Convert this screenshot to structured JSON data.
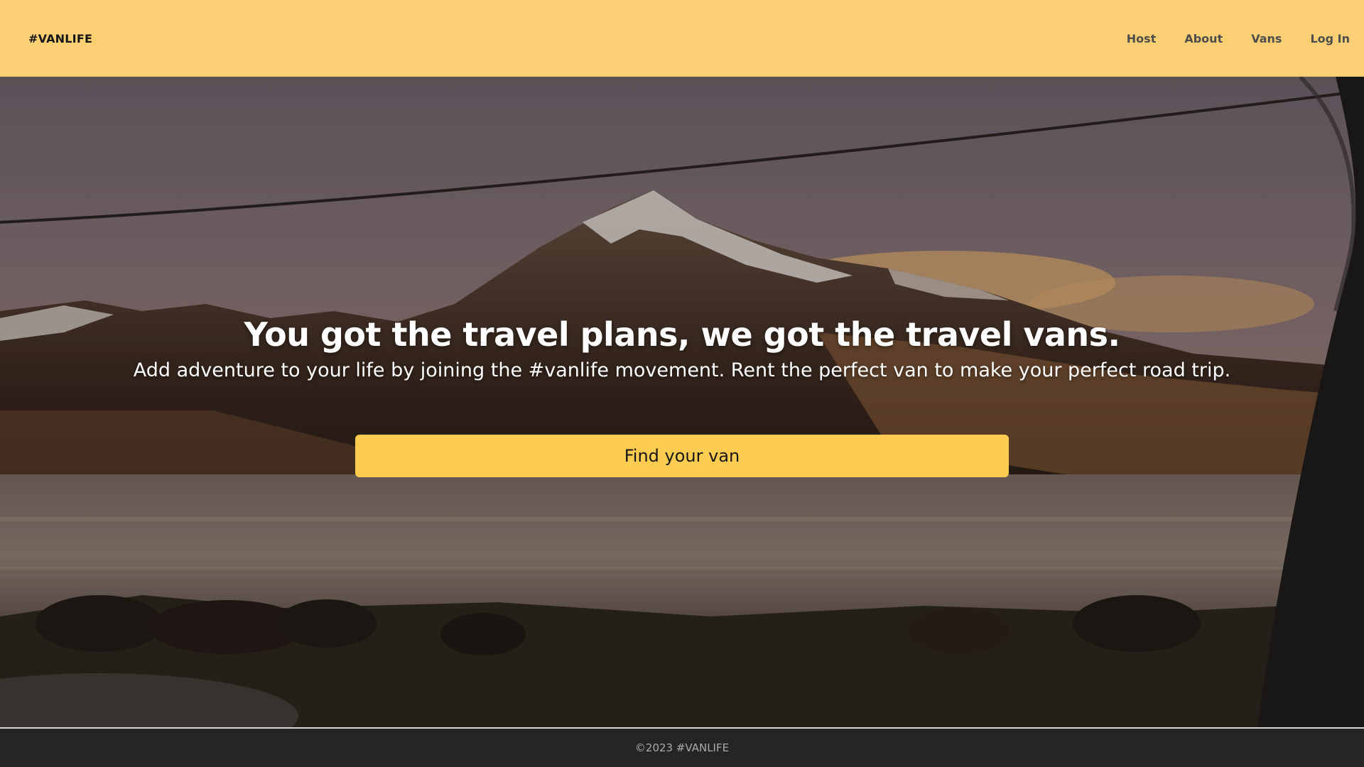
{
  "header": {
    "logo": "#VANLIFE",
    "nav": [
      {
        "label": "Host"
      },
      {
        "label": "About"
      },
      {
        "label": "Vans"
      },
      {
        "label": "Log In"
      }
    ]
  },
  "hero": {
    "title": "You got the travel plans, we got the travel vans.",
    "subtitle": "Add adventure to your life by joining the #vanlife movement. Rent the perfect van to make your perfect road trip.",
    "cta_label": "Find your van"
  },
  "footer": {
    "text": "©2023 #VANLIFE"
  },
  "colors": {
    "header_bg": "#FBD074",
    "cta_bg": "#FFCC52",
    "footer_bg": "#252525"
  }
}
